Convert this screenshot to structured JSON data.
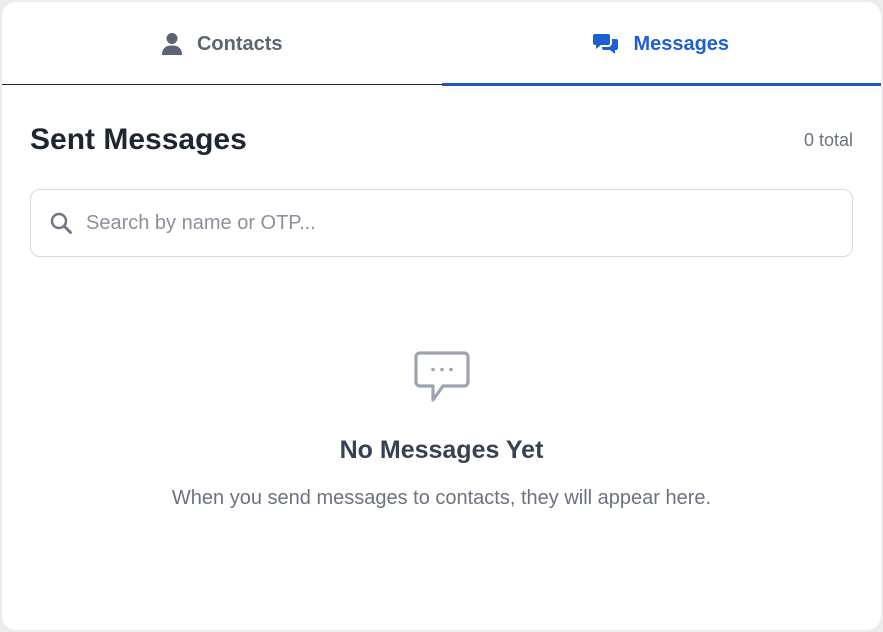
{
  "tabs": [
    {
      "label": "Contacts",
      "icon": "user-icon",
      "active": false
    },
    {
      "label": "Messages",
      "icon": "chat-bubbles-icon",
      "active": true
    }
  ],
  "header": {
    "title": "Sent Messages",
    "count": "0 total"
  },
  "search": {
    "placeholder": "Search by name or OTP...",
    "value": "",
    "icon": "search-icon"
  },
  "empty_state": {
    "icon": "comment-dots-icon",
    "title": "No Messages Yet",
    "subtitle": "When you send messages to contacts, they will appear here."
  },
  "colors": {
    "accent": "#1d5fd6",
    "title": "#1e2533",
    "muted": "#6b7280",
    "icon_gray": "#9ca3af"
  }
}
